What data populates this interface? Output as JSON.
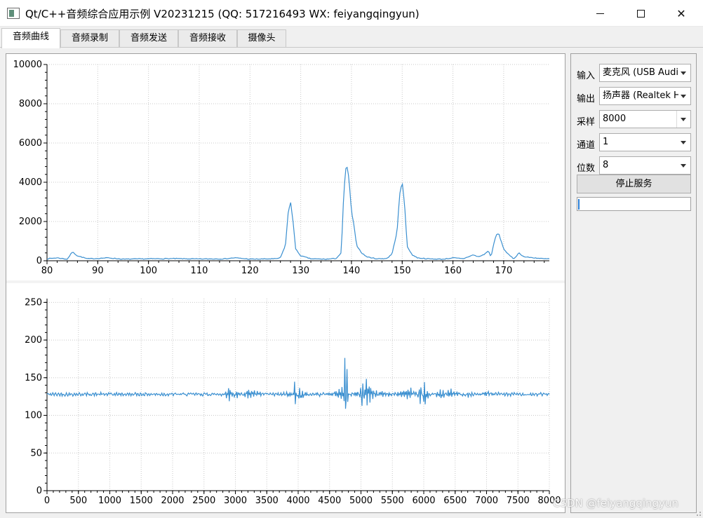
{
  "window": {
    "title": "Qt/C++音频综合应用示例 V20231215 (QQ: 517216493 WX: feiyangqingyun)",
    "icon": "app-window-icon",
    "minimize_icon": "minimize-icon",
    "maximize_icon": "maximize-icon",
    "close_icon": "close-icon"
  },
  "tabs": [
    {
      "label": "音频曲线",
      "active": true
    },
    {
      "label": "音频录制",
      "active": false
    },
    {
      "label": "音频发送",
      "active": false
    },
    {
      "label": "音频接收",
      "active": false
    },
    {
      "label": "摄像头",
      "active": false
    }
  ],
  "side": {
    "input_label": "输入",
    "input_value": "麦克风 (USB Audio",
    "output_label": "输出",
    "output_value": "扬声器 (Realtek H",
    "sample_label": "采样",
    "sample_value": "8000",
    "channel_label": "通道",
    "channel_value": "1",
    "bits_label": "位数",
    "bits_value": "8",
    "stop_button": "停止服务",
    "level": 0.01
  },
  "watermark": "CSDN @feiyangqingyun",
  "colors": {
    "curve": "#3a8fd0",
    "grid": "#c8c8c8",
    "accent": "#2b7fd6"
  },
  "chart_data": [
    {
      "type": "line",
      "title": "",
      "xlabel": "",
      "ylabel": "",
      "xlim": [
        80,
        179
      ],
      "ylim": [
        0,
        10000
      ],
      "xticks": [
        80,
        90,
        100,
        110,
        120,
        130,
        140,
        150,
        160,
        170
      ],
      "yticks": [
        0,
        2000,
        4000,
        6000,
        8000,
        10000
      ],
      "grid": true,
      "series": [
        {
          "x": [
            80,
            82,
            84,
            85,
            86,
            88,
            90,
            92,
            95,
            100,
            105,
            110,
            115,
            117,
            120,
            125,
            126,
            127,
            127.5,
            128,
            128.5,
            129,
            130,
            132,
            135,
            137,
            138,
            138.5,
            139,
            139.5,
            140,
            140.5,
            141,
            142,
            143,
            145,
            147,
            148,
            149,
            149.5,
            150,
            150.5,
            151,
            152,
            153,
            155,
            158,
            160,
            162,
            164,
            165,
            166,
            167,
            167.5,
            168,
            168.5,
            169,
            169.5,
            170,
            171,
            172,
            173,
            174,
            176,
            178,
            179
          ],
          "y": [
            100,
            150,
            80,
            450,
            250,
            100,
            120,
            150,
            80,
            100,
            110,
            90,
            100,
            150,
            80,
            100,
            150,
            800,
            2400,
            3000,
            2000,
            600,
            250,
            100,
            80,
            120,
            400,
            3500,
            5000,
            4200,
            2500,
            1800,
            800,
            400,
            200,
            100,
            120,
            350,
            1500,
            3400,
            4000,
            2800,
            700,
            300,
            150,
            100,
            80,
            150,
            100,
            300,
            200,
            300,
            500,
            200,
            800,
            1300,
            1400,
            1000,
            600,
            300,
            100,
            400,
            200,
            150,
            100,
            100
          ]
        }
      ]
    },
    {
      "type": "line",
      "title": "",
      "xlabel": "",
      "ylabel": "",
      "xlim": [
        0,
        8000
      ],
      "ylim": [
        0,
        255
      ],
      "xticks": [
        0,
        500,
        1000,
        1500,
        2000,
        2500,
        3000,
        3500,
        4000,
        4500,
        5000,
        5500,
        6000,
        6500,
        7000,
        7500,
        8000
      ],
      "yticks": [
        0,
        50,
        100,
        150,
        200,
        250
      ],
      "grid": true,
      "baseline": 128,
      "series": [
        {
          "x": [
            0,
            1000,
            2000,
            2800,
            2900,
            3000,
            3200,
            3500,
            3900,
            3950,
            4000,
            4200,
            4600,
            4720,
            4750,
            4780,
            4800,
            5000,
            5030,
            5060,
            5200,
            5500,
            5800,
            5900,
            5950,
            6000,
            6100,
            6300,
            6400,
            6700,
            7000,
            7500,
            8000
          ],
          "y": [
            128,
            128,
            128,
            128,
            134,
            124,
            132,
            128,
            126,
            140,
            122,
            128,
            130,
            135,
            162,
            90,
            128,
            132,
            110,
            143,
            132,
            128,
            133,
            123,
            140,
            114,
            130,
            123,
            133,
            126,
            130,
            128,
            128
          ]
        }
      ]
    }
  ]
}
